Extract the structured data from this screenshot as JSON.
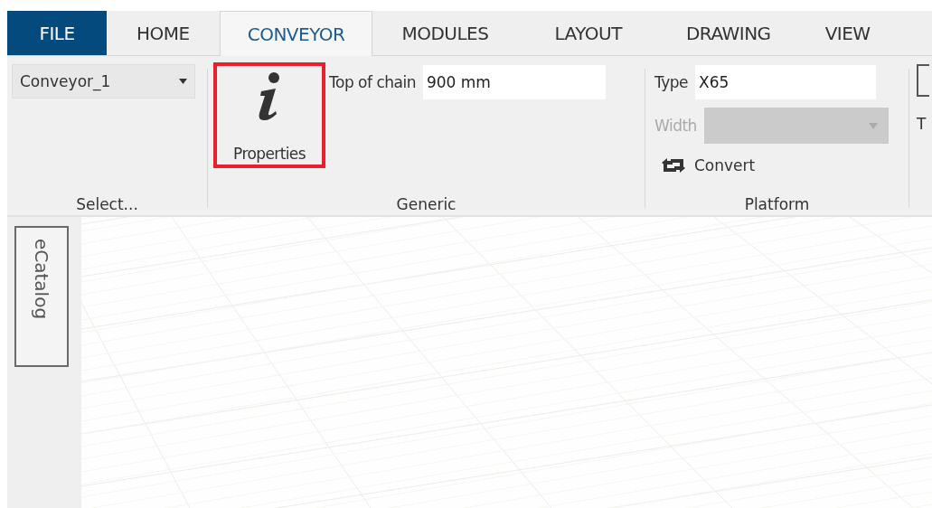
{
  "tabs": [
    {
      "label": "FILE",
      "kind": "file",
      "selected": false
    },
    {
      "label": "HOME",
      "kind": "tab",
      "selected": false
    },
    {
      "label": "CONVEYOR",
      "kind": "tab",
      "selected": true
    },
    {
      "label": "MODULES",
      "kind": "tab",
      "selected": false
    },
    {
      "label": "LAYOUT",
      "kind": "tab",
      "selected": false
    },
    {
      "label": "DRAWING",
      "kind": "tab",
      "selected": false
    },
    {
      "label": "VIEW",
      "kind": "tab",
      "selected": false
    }
  ],
  "ribbon": {
    "select_group": {
      "dropdown_value": "Conveyor_1",
      "caption": "Select..."
    },
    "generic_group": {
      "properties_button": {
        "label": "Properties",
        "highlighted": true
      },
      "top_of_chain_label": "Top of chain",
      "top_of_chain_value": "900 mm",
      "caption": "Generic"
    },
    "platform_group": {
      "type_label": "Type",
      "type_value": "X65",
      "width_label": "Width",
      "width_disabled": true,
      "convert_button": "Convert",
      "caption": "Platform"
    },
    "cut_group": {
      "label": "T"
    }
  },
  "side_panel": {
    "tab": "eCatalog"
  }
}
